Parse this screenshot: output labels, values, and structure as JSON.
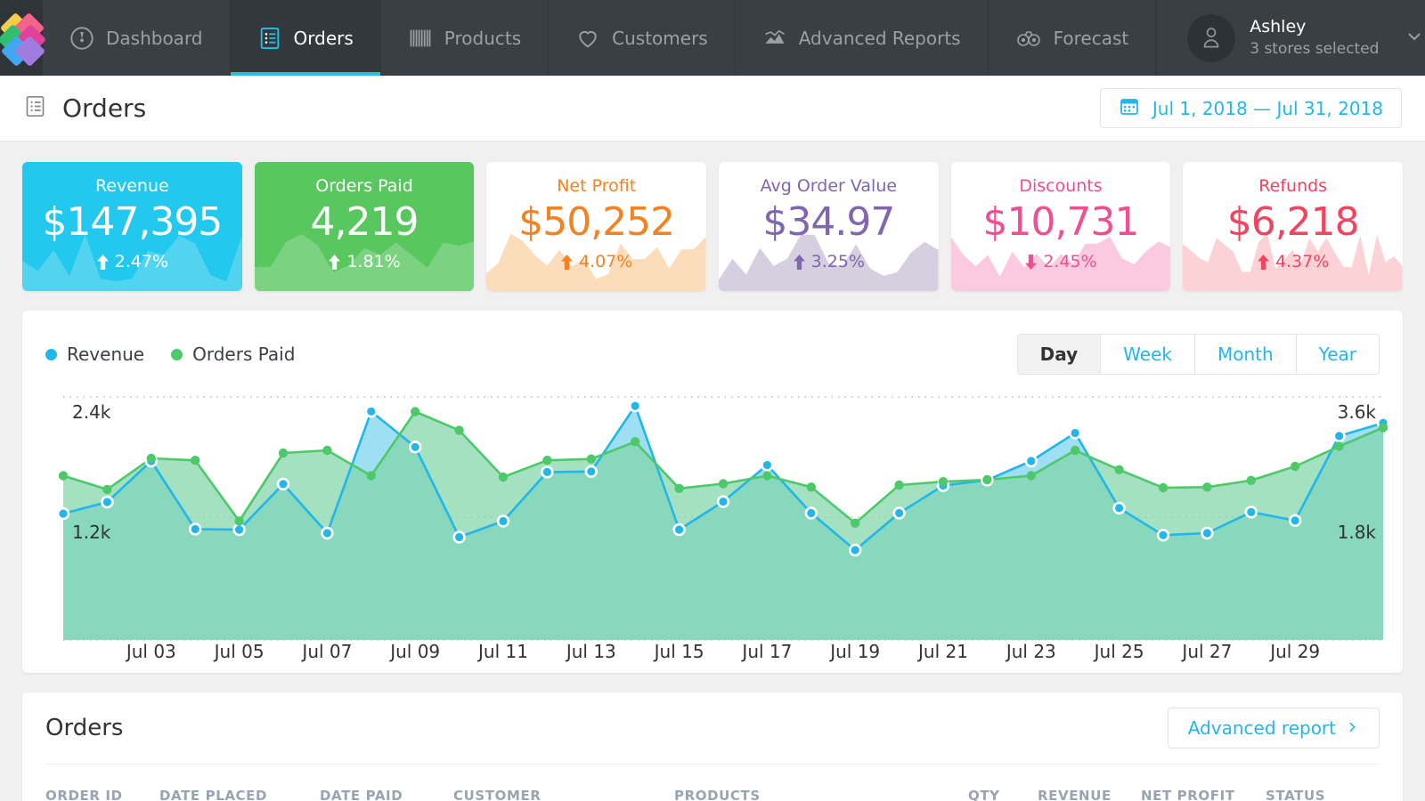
{
  "navbar": {
    "logo_name": "app-logo",
    "items": [
      {
        "label": "Dashboard",
        "icon": "speedometer-icon",
        "active": false
      },
      {
        "label": "Orders",
        "icon": "list-document-icon",
        "active": true
      },
      {
        "label": "Products",
        "icon": "barcode-icon",
        "active": false
      },
      {
        "label": "Customers",
        "icon": "heart-icon",
        "active": false
      },
      {
        "label": "Advanced Reports",
        "icon": "mountain-chart-icon",
        "active": false
      },
      {
        "label": "Forecast",
        "icon": "binoculars-icon",
        "active": false
      }
    ],
    "user": {
      "name": "Ashley",
      "subtitle": "3 stores selected",
      "avatar_icon": "person-icon",
      "chevron_icon": "chevron-down-icon"
    }
  },
  "page_header": {
    "title": "Orders",
    "title_icon": "list-document-icon",
    "date_range": "Jul 1, 2018 — Jul 31, 2018",
    "date_icon": "calendar-icon"
  },
  "kpis": [
    {
      "label": "Revenue",
      "value": "$147,395",
      "delta": "2.47%",
      "direction": "up",
      "style": "filled",
      "accent": "#22c8ed",
      "spark": "#ffffff",
      "spark_opacity": 0.22
    },
    {
      "label": "Orders Paid",
      "value": "4,219",
      "delta": "1.81%",
      "direction": "up",
      "style": "filled",
      "accent": "#57c75e",
      "spark": "#ffffff",
      "spark_opacity": 0.22
    },
    {
      "label": "Net Profit",
      "value": "$50,252",
      "delta": "4.07%",
      "direction": "up",
      "style": "light",
      "accent": "#f58220",
      "spark": "#fbdcbb",
      "spark_opacity": 1
    },
    {
      "label": "Avg Order Value",
      "value": "$34.97",
      "delta": "3.25%",
      "direction": "up",
      "style": "light",
      "accent": "#8065b0",
      "spark": "#d5cfe0",
      "spark_opacity": 1
    },
    {
      "label": "Discounts",
      "value": "$10,731",
      "delta": "2.45%",
      "direction": "down",
      "style": "light",
      "accent": "#ef4f91",
      "spark": "#fbc9e0",
      "spark_opacity": 1
    },
    {
      "label": "Refunds",
      "value": "$6,218",
      "delta": "4.37%",
      "direction": "up",
      "style": "light",
      "accent": "#f2445f",
      "spark": "#fbd3d7",
      "spark_opacity": 1
    }
  ],
  "chart_card": {
    "legend": [
      {
        "label": "Revenue",
        "color": "#22b6ea"
      },
      {
        "label": "Orders Paid",
        "color": "#4ec96a"
      }
    ],
    "granularity": [
      {
        "label": "Day",
        "active": true
      },
      {
        "label": "Week",
        "active": false
      },
      {
        "label": "Month",
        "active": false
      },
      {
        "label": "Year",
        "active": false
      }
    ]
  },
  "chart_data": {
    "type": "area",
    "title": "",
    "xlabel": "",
    "ylabel": "",
    "grid": true,
    "legend_position": "top-left",
    "x": [
      "Jul 01",
      "Jul 02",
      "Jul 03",
      "Jul 04",
      "Jul 05",
      "Jul 06",
      "Jul 07",
      "Jul 08",
      "Jul 09",
      "Jul 10",
      "Jul 11",
      "Jul 12",
      "Jul 13",
      "Jul 14",
      "Jul 15",
      "Jul 16",
      "Jul 17",
      "Jul 18",
      "Jul 19",
      "Jul 20",
      "Jul 21",
      "Jul 22",
      "Jul 23",
      "Jul 24",
      "Jul 25",
      "Jul 26",
      "Jul 27",
      "Jul 28",
      "Jul 29",
      "Jul 30",
      "Jul 31"
    ],
    "xtick_labels": [
      "Jul 03",
      "Jul 05",
      "Jul 07",
      "Jul 09",
      "Jul 11",
      "Jul 13",
      "Jul 15",
      "Jul 17",
      "Jul 19",
      "Jul 21",
      "Jul 23",
      "Jul 25",
      "Jul 27",
      "Jul 29"
    ],
    "xtick_indices": [
      2,
      4,
      6,
      8,
      10,
      12,
      14,
      16,
      18,
      20,
      22,
      24,
      26,
      28
    ],
    "left_axis": {
      "name": "Revenue",
      "tick_labels": [
        "2.4k",
        "1.2k"
      ],
      "tick_values": [
        2400,
        1200
      ],
      "ylim": [
        0,
        2400
      ]
    },
    "right_axis": {
      "name": "Orders Paid",
      "tick_labels": [
        "3.6k",
        "1.8k"
      ],
      "tick_values": [
        3600,
        1800
      ],
      "ylim": [
        0,
        3600
      ]
    },
    "series": [
      {
        "name": "Revenue",
        "axis": "left",
        "color": "#22b6ea",
        "fill": "#8ed9f2",
        "values": [
          1235,
          1350,
          1760,
          1080,
          1075,
          1530,
          1040,
          2255,
          1900,
          1000,
          1160,
          1650,
          1655,
          2310,
          1075,
          1355,
          1720,
          1240,
          870,
          1240,
          1515,
          1570,
          1760,
          2040,
          1290,
          1020,
          1040,
          1250,
          1165,
          2010,
          2140
        ]
      },
      {
        "name": "Orders Paid",
        "axis": "right",
        "color": "#4ec96a",
        "fill": "#a7e0a8",
        "values": [
          2420,
          2215,
          2680,
          2650,
          1740,
          2760,
          2800,
          2420,
          3380,
          3100,
          2400,
          2650,
          2670,
          2930,
          2230,
          2300,
          2420,
          2250,
          1710,
          2280,
          2330,
          2360,
          2420,
          2800,
          2510,
          2240,
          2250,
          2350,
          2560,
          2860,
          3140
        ]
      }
    ]
  },
  "orders_section": {
    "title": "Orders",
    "advanced_report_label": "Advanced report",
    "advanced_report_icon": "chevron-right-icon",
    "columns": [
      "ORDER ID",
      "DATE PLACED",
      "DATE PAID",
      "CUSTOMER",
      "PRODUCTS",
      "QTY",
      "REVENUE",
      "NET PROFIT",
      "STATUS"
    ]
  }
}
